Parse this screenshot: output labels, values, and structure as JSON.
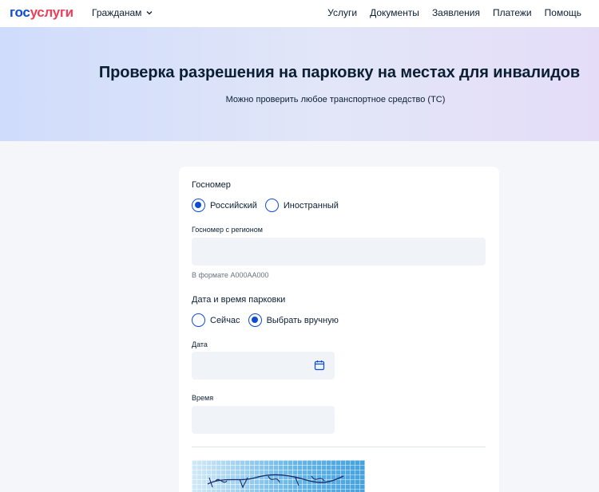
{
  "header": {
    "logo_gos": "гос",
    "logo_uslugi": "услуги",
    "audience": "Гражданам",
    "nav": [
      "Услуги",
      "Документы",
      "Заявления",
      "Платежи",
      "Помощь"
    ]
  },
  "banner": {
    "title": "Проверка разрешения на парковку на местах для инвалидов",
    "subtitle": "Можно проверить любое транспортное средство (ТС)"
  },
  "form": {
    "plate_section": {
      "label": "Госномер",
      "options": [
        "Российский",
        "Иностранный"
      ],
      "selected": "Российский"
    },
    "plate_field": {
      "label": "Госномер с регионом",
      "value": "",
      "placeholder": "",
      "hint": "В формате А000АА000"
    },
    "datetime_section": {
      "label": "Дата и время парковки",
      "options": [
        "Сейчас",
        "Выбрать вручную"
      ],
      "selected": "Выбрать вручную"
    },
    "date_field": {
      "label": "Дата",
      "value": "",
      "icon": "calendar-icon"
    },
    "time_field": {
      "label": "Время",
      "value": ""
    }
  },
  "colors": {
    "accent": "#0d4cd3",
    "logo_red": "#ee3f58",
    "text": "#0b1f33",
    "hint": "#66727f",
    "input_bg": "#f0f3f7"
  }
}
